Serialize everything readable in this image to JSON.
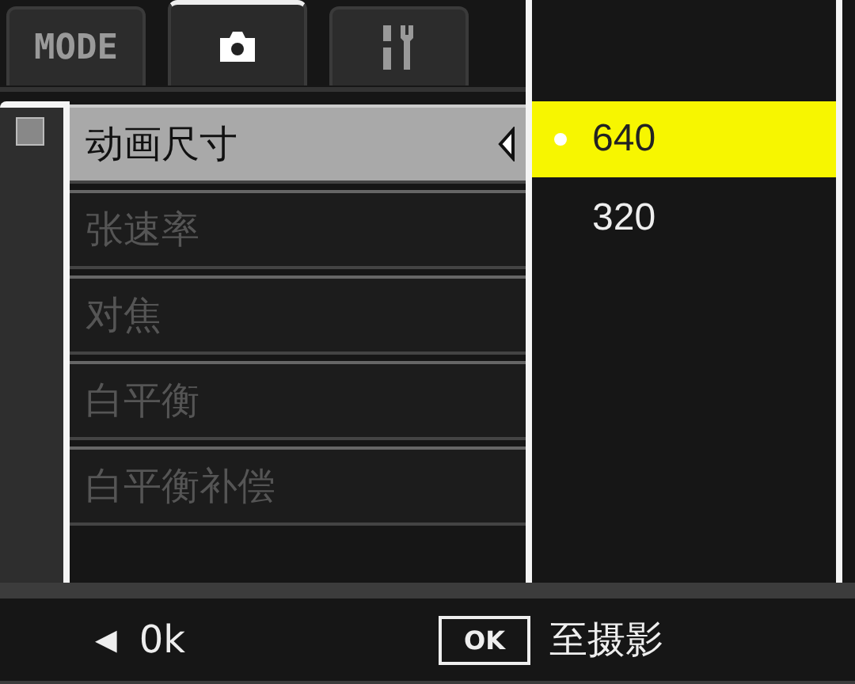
{
  "tabs": [
    {
      "kind": "text",
      "label": "MODE",
      "selected": false
    },
    {
      "kind": "camera",
      "selected": true
    },
    {
      "kind": "tools",
      "selected": false
    }
  ],
  "menu": {
    "items": [
      {
        "label": "动画尺寸",
        "selected": true,
        "disabled": false
      },
      {
        "label": "张速率",
        "selected": false,
        "disabled": true
      },
      {
        "label": "对焦",
        "selected": false,
        "disabled": true
      },
      {
        "label": "白平衡",
        "selected": false,
        "disabled": true
      },
      {
        "label": "白平衡补偿",
        "selected": false,
        "disabled": true
      }
    ]
  },
  "options": [
    {
      "label": "640",
      "selected": true
    },
    {
      "label": "320",
      "selected": false
    }
  ],
  "footer": {
    "back_arrow": "◀",
    "back_label": "0k",
    "ok_key": "OK",
    "ok_label": "至摄影"
  }
}
